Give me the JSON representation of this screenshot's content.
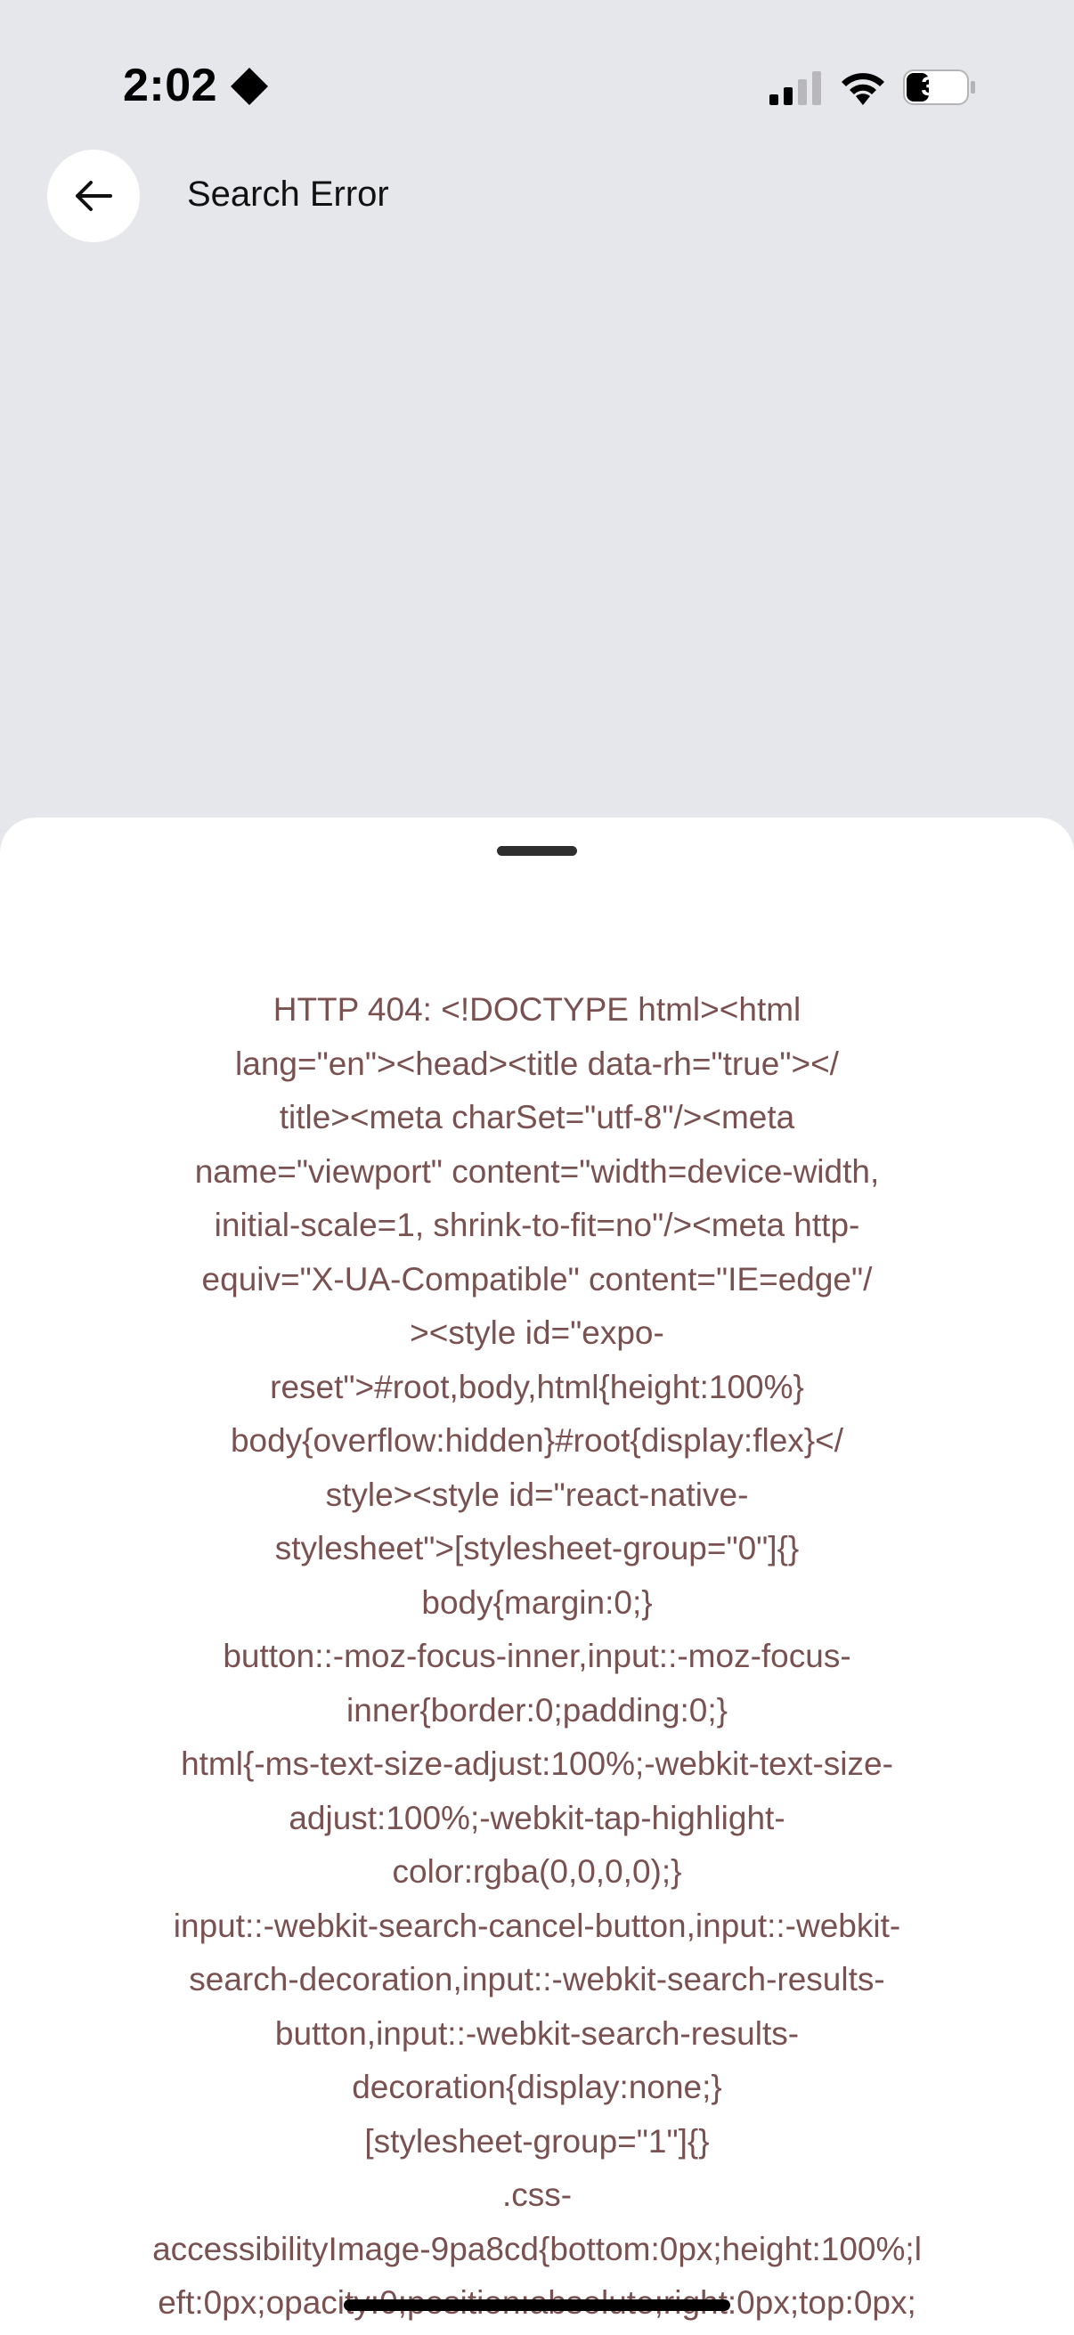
{
  "status_bar": {
    "time": "2:02",
    "battery": "33",
    "icons": [
      "location-arrow-icon",
      "cellular-signal-icon",
      "wifi-icon",
      "battery-icon"
    ]
  },
  "header": {
    "back_icon": "arrow-left-icon",
    "title": "Search Error"
  },
  "sheet": {
    "error_lines": [
      "HTTP 404: <!DOCTYPE html><html",
      "lang=\"en\"><head><title data-rh=\"true\"></",
      "title><meta charSet=\"utf-8\"/><meta",
      "name=\"viewport\" content=\"width=device-width,",
      "initial-scale=1, shrink-to-fit=no\"/><meta http-",
      "equiv=\"X-UA-Compatible\" content=\"IE=edge\"/",
      "><style id=\"expo-",
      "reset\">#root,body,html{height:100%}",
      "body{overflow:hidden}#root{display:flex}</",
      "style><style id=\"react-native-",
      "stylesheet\">[stylesheet-group=\"0\"]{}",
      "body{margin:0;}",
      "button::-moz-focus-inner,input::-moz-focus-",
      "inner{border:0;padding:0;}",
      "html{-ms-text-size-adjust:100%;-webkit-text-size-",
      "adjust:100%;-webkit-tap-highlight-",
      "color:rgba(0,0,0,0);}",
      "input::-webkit-search-cancel-button,input::-webkit-",
      "search-decoration,input::-webkit-search-results-",
      "button,input::-webkit-search-results-",
      "decoration{display:none;}",
      "[stylesheet-group=\"1\"]{}",
      ".css-",
      "accessibilityImage-9pa8cd{bottom:0px;height:100%;l",
      "eft:0px;opacity:0;position:absolute;right:0px;top:0px;"
    ]
  },
  "colors": {
    "background": "#e6e7eb",
    "sheet": "#ffffff",
    "error_text": "#7a5151"
  }
}
